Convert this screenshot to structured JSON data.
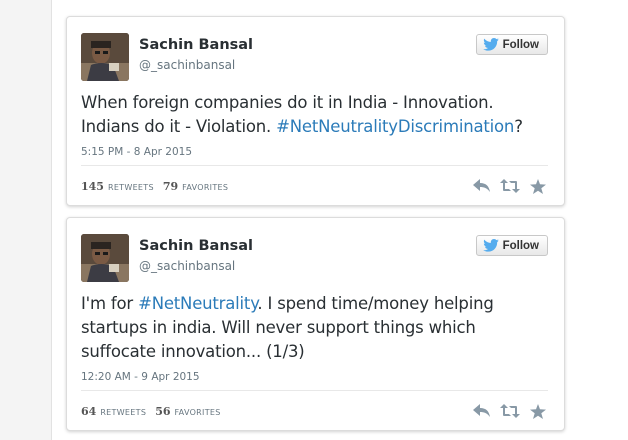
{
  "tweets": [
    {
      "author_name": "Sachin Bansal",
      "author_handle": "@_sachinbansal",
      "follow_label": "Follow",
      "text_parts": [
        "When foreign companies do it in India - Innovation. Indians do it - Violation. ",
        "#NetNeutralityDiscrimination",
        "?"
      ],
      "timestamp": "5:15 PM - 8 Apr 2015",
      "retweets_count": "145",
      "retweets_label": "Retweets",
      "favorites_count": "79",
      "favorites_label": "Favorites"
    },
    {
      "author_name": "Sachin Bansal",
      "author_handle": "@_sachinbansal",
      "follow_label": "Follow",
      "text_parts": [
        "I'm for ",
        "#NetNeutrality",
        ". I spend time/money helping startups in india. Will never support things which suffocate innovation... (1/3)"
      ],
      "timestamp": "12:20 AM - 9 Apr 2015",
      "retweets_count": "64",
      "retweets_label": "Retweets",
      "favorites_count": "56",
      "favorites_label": "Favorites"
    }
  ],
  "colors": {
    "link": "#2b7bb9",
    "text": "#292f33",
    "muted": "#66757f",
    "twitter_blue": "#55acee"
  },
  "icons": [
    "twitter-bird-icon",
    "reply-icon",
    "retweet-icon",
    "favorite-star-icon"
  ]
}
